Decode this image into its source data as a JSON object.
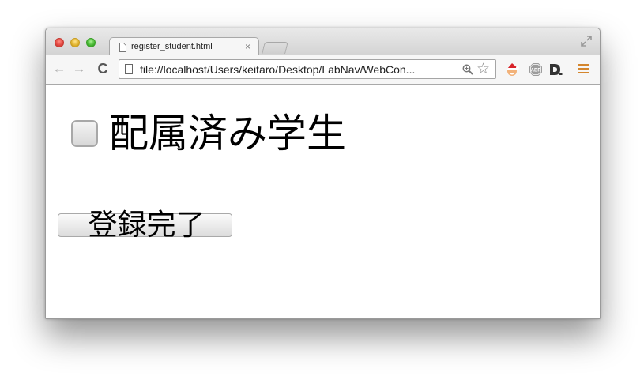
{
  "browser": {
    "tab": {
      "title": "register_student.html",
      "close_glyph": "×"
    },
    "toolbar": {
      "back_glyph": "←",
      "forward_glyph": "→",
      "reload_glyph": "C",
      "url": "file://localhost/Users/keitaro/Desktop/LabNav/WebCon...",
      "star_glyph": "☆"
    },
    "icons": {
      "tab": "file-icon",
      "url": "file-icon",
      "zoom": "zoom-icon",
      "bookmark": "star-icon",
      "extensions": [
        "santa-extension-icon",
        "adblock-plus-icon",
        "d-logo-icon"
      ],
      "menu": "hamburger-menu-icon"
    },
    "colors": {
      "menu_icon": "#d4862e",
      "close_button": "#e0443e",
      "minimize_button": "#e0b22c",
      "maximize_button": "#45b631"
    }
  },
  "form": {
    "checkbox": {
      "label": "配属済み学生",
      "checked": false
    },
    "submit_label": "登録完了"
  }
}
